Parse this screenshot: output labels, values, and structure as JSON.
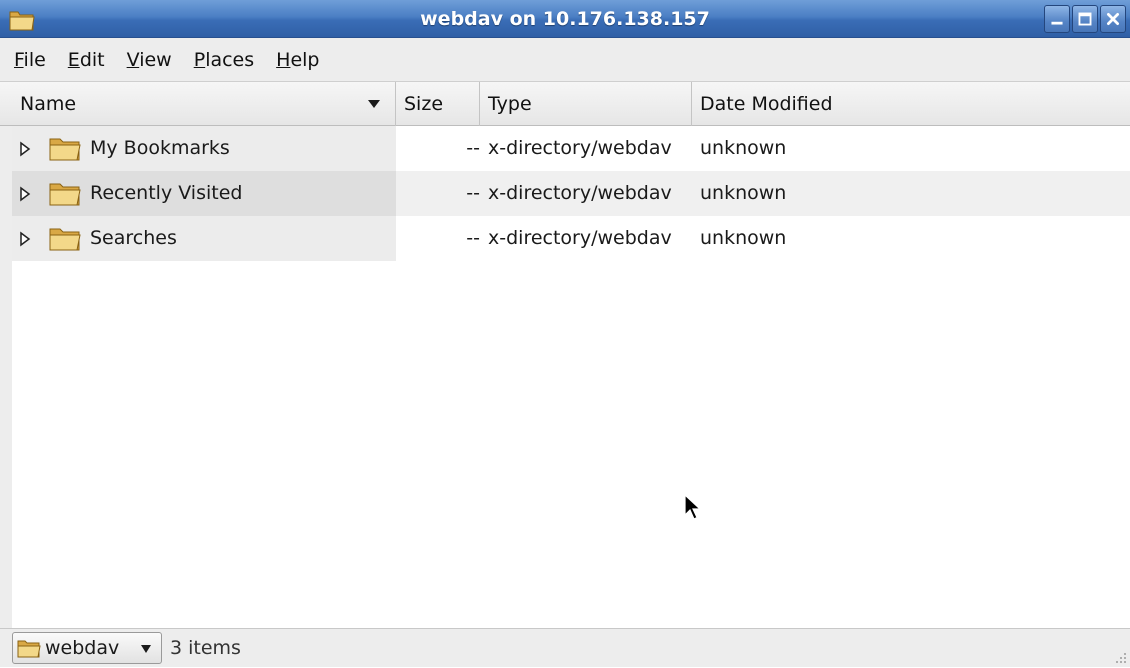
{
  "window": {
    "title": "webdav on 10.176.138.157",
    "app_icon": "folder-icon",
    "controls": [
      "minimize-icon",
      "maximize-icon",
      "close-icon"
    ]
  },
  "menubar": {
    "items": [
      {
        "mnemonic": "F",
        "rest": "ile"
      },
      {
        "mnemonic": "E",
        "rest": "dit"
      },
      {
        "mnemonic": "V",
        "rest": "iew"
      },
      {
        "mnemonic": "P",
        "rest": "laces"
      },
      {
        "mnemonic": "H",
        "rest": "elp"
      }
    ]
  },
  "columns": {
    "name": "Name",
    "size": "Size",
    "type": "Type",
    "date": "Date Modified"
  },
  "rows": [
    {
      "name": "My Bookmarks",
      "size": "--",
      "type": "x-directory/webdav",
      "date": "unknown"
    },
    {
      "name": "Recently Visited",
      "size": "--",
      "type": "x-directory/webdav",
      "date": "unknown"
    },
    {
      "name": "Searches",
      "size": "--",
      "type": "x-directory/webdav",
      "date": "unknown"
    }
  ],
  "statusbar": {
    "location": "webdav",
    "item_count": "3 items"
  },
  "colors": {
    "titlebar": "#3a6db6",
    "folder": "#e8c36a"
  }
}
